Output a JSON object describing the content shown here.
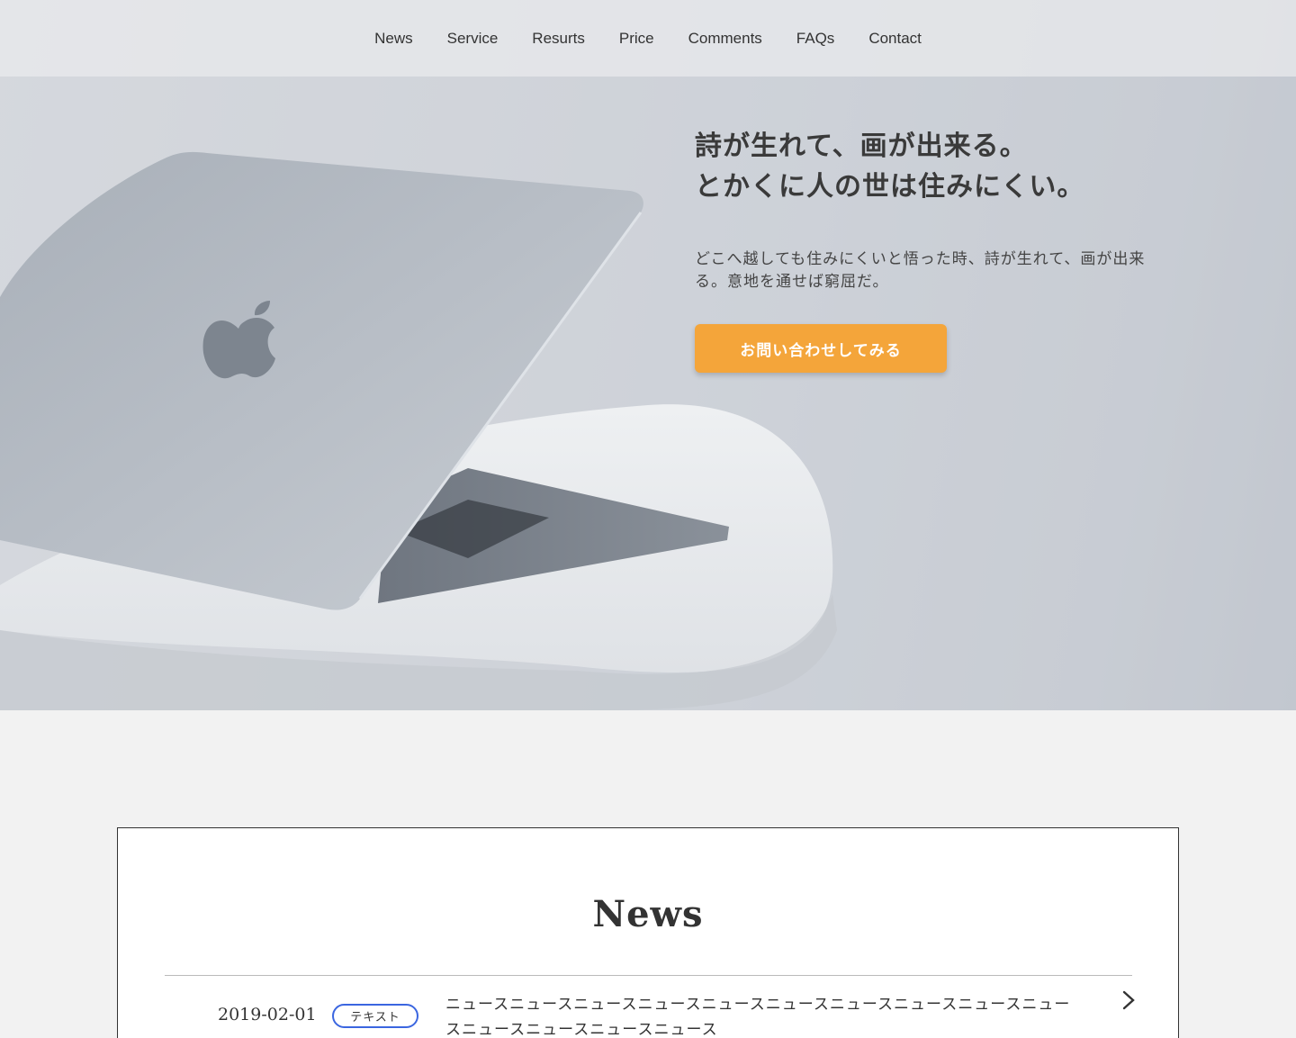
{
  "nav": {
    "items": [
      {
        "label": "News"
      },
      {
        "label": "Service"
      },
      {
        "label": "Resurts"
      },
      {
        "label": "Price"
      },
      {
        "label": "Comments"
      },
      {
        "label": "FAQs"
      },
      {
        "label": "Contact"
      }
    ]
  },
  "hero": {
    "title_line1": "詩が生れて、画が出来る。",
    "title_line2": "とかくに人の世は住みにくい。",
    "text": "どこへ越しても住みにくいと悟った時、詩が生れて、画が出来る。意地を通せば窮屈だ。",
    "cta_label": "お問い合わせしてみる",
    "cta_color": "#f4a53a"
  },
  "news": {
    "title": "News",
    "items": [
      {
        "date": "2019-02-01",
        "tag": "テキスト",
        "text": "ニュースニュースニュースニュースニュースニュースニュースニュースニュースニュースニュースニュースニュースニュース",
        "arrow_icon": "chevron-right-icon"
      }
    ],
    "tag_border_color": "#3b66e0"
  }
}
